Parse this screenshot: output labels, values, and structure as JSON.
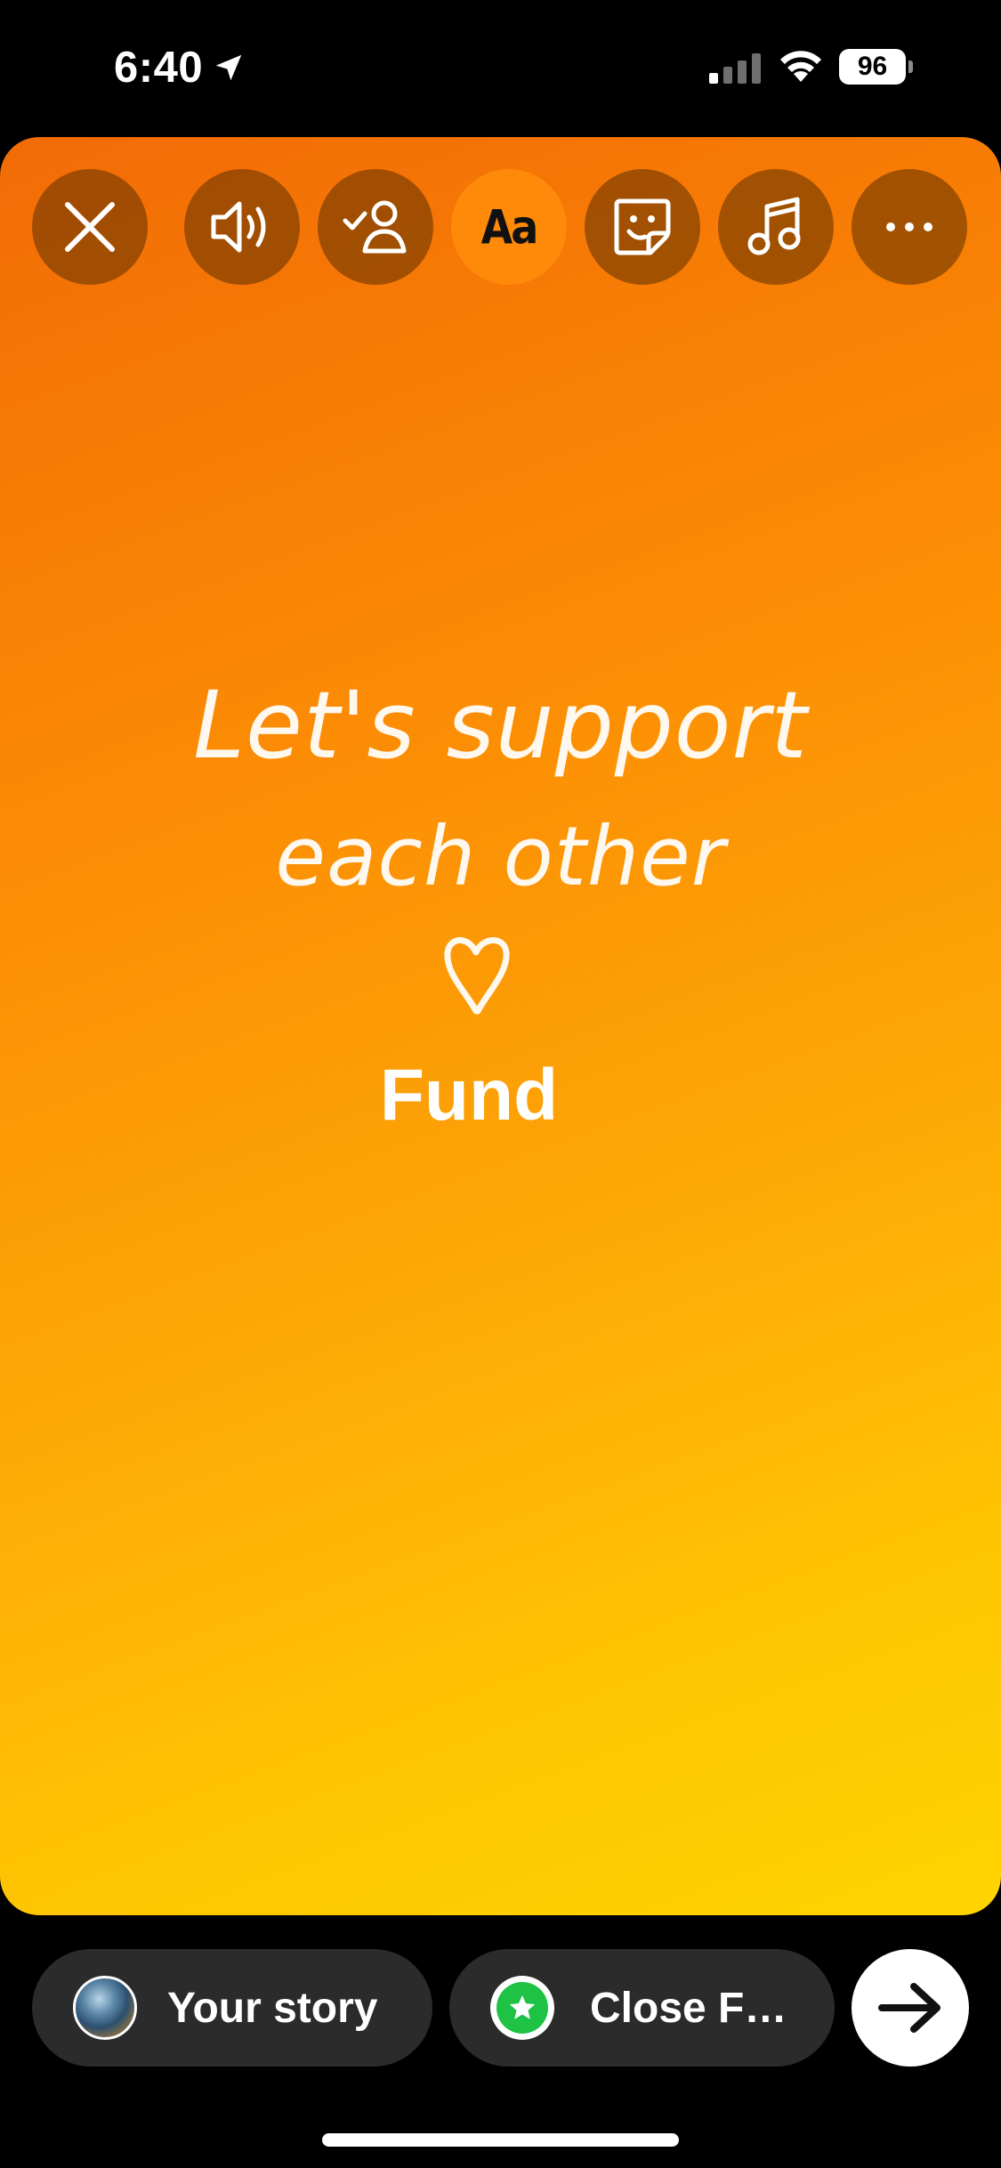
{
  "status_bar": {
    "time": "6:40",
    "battery": "96"
  },
  "toolbar": {
    "close": "close-icon",
    "sound": "speaker-icon",
    "mention": "tag-people-icon",
    "text_tool_label": "Aa",
    "sticker": "sticker-icon",
    "music": "music-note-icon",
    "more": "more-icon"
  },
  "story": {
    "line1": "Let's support",
    "line2": "each other",
    "heart": "heart-icon",
    "fund_label": "Fund"
  },
  "share_bar": {
    "your_story_label": "Your story",
    "close_friends_label": "Close F…",
    "next": "arrow-right-icon"
  },
  "colors": {
    "gradient_start": "#f26b06",
    "gradient_end": "#ffd400",
    "close_friends_green": "#1ec244",
    "pill_bg": "#2b2b2b"
  }
}
